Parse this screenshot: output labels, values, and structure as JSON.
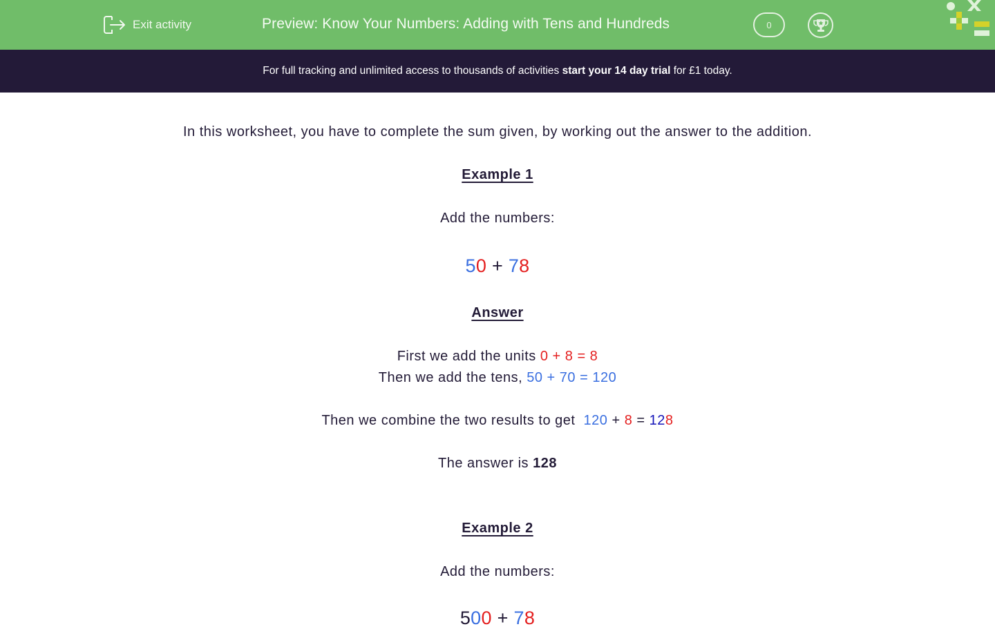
{
  "header": {
    "exit_label": "Exit activity",
    "title": "Preview: Know Your Numbers: Adding with Tens and Hundreds",
    "score": "0",
    "icons": [
      "exit-icon",
      "trophy-icon",
      "maths-symbols-logo"
    ]
  },
  "banner": {
    "text_before": "For full tracking and unlimited access to thousands of activities ",
    "text_bold": "start your 14 day trial",
    "text_after": " for £1 today."
  },
  "colors": {
    "header_green": "#70bd69",
    "banner_dark": "#231a38",
    "text_dark": "#221a36",
    "tens_blue": "#3a6fe0",
    "units_red": "#e41f1f",
    "result_navy": "#1414b8"
  },
  "intro": "In this worksheet, you have to complete the sum given, by working out the answer to the addition.",
  "example1": {
    "heading": "Example 1",
    "prompt": "Add the numbers:",
    "sum": {
      "a_tens": "5",
      "a_units": "0",
      "op": " + ",
      "b_tens": "7",
      "b_units": "8"
    },
    "answer_heading": "Answer",
    "units_line": {
      "text": "First we add the units ",
      "calc": "0 + 8 = 8"
    },
    "tens_line": {
      "text": "Then we add the tens, ",
      "calc": "50 + 70 = 120"
    },
    "combine_line": {
      "text": "Then we combine the two results to get  ",
      "part1": "120",
      "plus": " + ",
      "part2": "8",
      "equals": " = ",
      "result_tens": "12",
      "result_units": "8"
    },
    "final": {
      "text": "The answer is ",
      "value": "128"
    }
  },
  "example2": {
    "heading": "Example 2",
    "prompt": "Add the numbers:",
    "sum": {
      "a_hundreds": "5",
      "a_tens": "0",
      "a_units": "0",
      "op": " + ",
      "b_tens": "7",
      "b_units": "8"
    }
  }
}
